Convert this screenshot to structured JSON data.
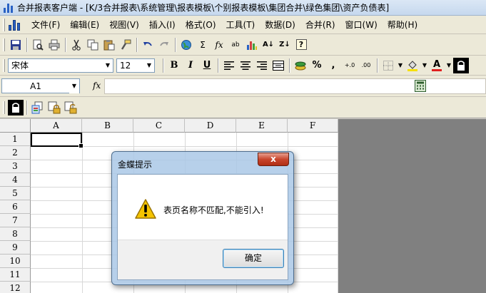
{
  "window": {
    "title": "合并报表客户端 - [K/3合并报表\\系统管理\\报表模板\\个别报表模板\\集团合并\\绿色集团\\资产负债表]"
  },
  "menu": [
    {
      "name": "file",
      "label": "文件(F)"
    },
    {
      "name": "edit",
      "label": "编辑(E)"
    },
    {
      "name": "view",
      "label": "视图(V)"
    },
    {
      "name": "insert",
      "label": "插入(I)"
    },
    {
      "name": "format",
      "label": "格式(O)"
    },
    {
      "name": "tools",
      "label": "工具(T)"
    },
    {
      "name": "data",
      "label": "数据(D)"
    },
    {
      "name": "merge",
      "label": "合并(R)"
    },
    {
      "name": "window",
      "label": "窗口(W)"
    },
    {
      "name": "help",
      "label": "帮助(H)"
    }
  ],
  "toolbar": {
    "sum_glyph": "Σ",
    "fx_glyph": "fx",
    "replace_glyph": "ab",
    "sort_asc_glyph": "A↓",
    "sort_desc_glyph": "Z↓",
    "help_glyph": "?"
  },
  "format_bar": {
    "font_name": "宋体",
    "font_size": "12",
    "bold": "B",
    "italic": "I",
    "underline": "U",
    "percent": "%",
    "comma": ",",
    "inc_decimal": "+.0",
    "dec_decimal": ".00",
    "font_color_glyph": "A"
  },
  "formula_bar": {
    "cell_ref": "A1",
    "fx_label": "fx",
    "value": ""
  },
  "grid": {
    "columns": [
      "A",
      "B",
      "C",
      "D",
      "E",
      "F"
    ],
    "rows": [
      "1",
      "2",
      "3",
      "4",
      "5",
      "6",
      "7",
      "8",
      "9",
      "10",
      "11",
      "12"
    ],
    "active_cell": "A1"
  },
  "dialog": {
    "title": "金蝶提示",
    "close_glyph": "x",
    "message": "表页名称不匹配,不能引入!",
    "ok_label": "确定"
  },
  "colors": {
    "titlebar": "#c6d8ee",
    "toolbar_bg": "#ece9d8",
    "grid_bg": "#ffffff",
    "workspace_bg": "#808080",
    "close_button": "#c8452c",
    "warning_yellow": "#f5c400"
  }
}
